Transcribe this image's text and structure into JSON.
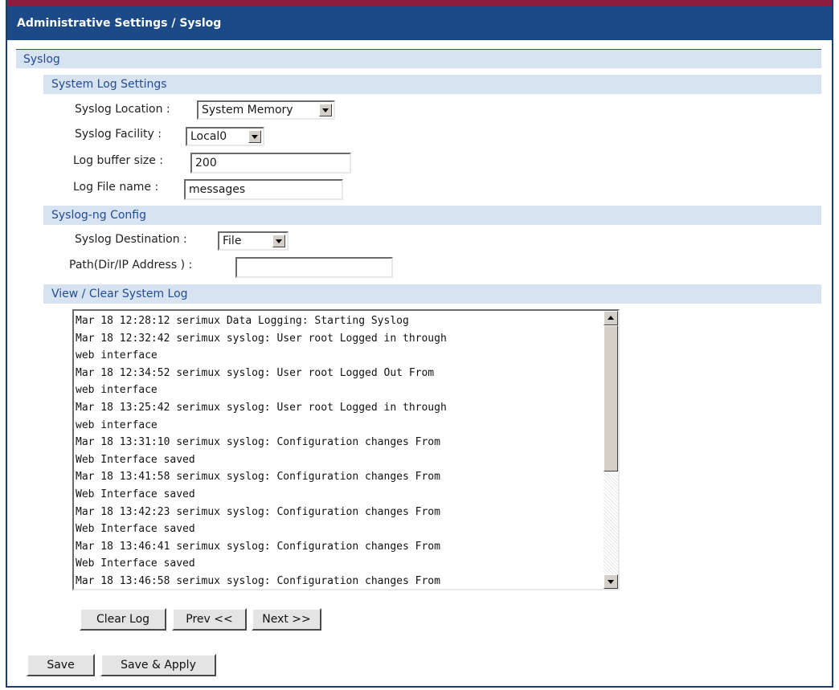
{
  "header": {
    "title": "Administrative Settings / Syslog"
  },
  "sections": {
    "syslog": "Syslog",
    "system_log_settings": "System Log Settings",
    "syslog_ng_config": "Syslog-ng Config",
    "view_clear": "View / Clear System Log"
  },
  "fields": {
    "syslog_location": {
      "label": "Syslog Location :",
      "value": "System Memory"
    },
    "syslog_facility": {
      "label": "Syslog Facility :",
      "value": "Local0"
    },
    "log_buffer_size": {
      "label": "Log buffer size :",
      "value": "200"
    },
    "log_file_name": {
      "label": "Log File name :",
      "value": "messages"
    },
    "syslog_destination": {
      "label": "Syslog Destination :",
      "value": "File"
    },
    "path": {
      "label": "Path(Dir/IP Address ) :",
      "value": ""
    }
  },
  "log": {
    "lines": [
      "Mar 18 12:28:12 serimux Data Logging: Starting Syslog",
      "Mar 18 12:32:42 serimux syslog: User root Logged in through",
      "web interface",
      "Mar 18 12:34:52 serimux syslog: User root Logged Out From",
      "web interface",
      "Mar 18 13:25:42 serimux syslog: User root Logged in through",
      "web interface",
      "Mar 18 13:31:10 serimux syslog: Configuration changes From",
      "Web Interface saved",
      "Mar 18 13:41:58 serimux syslog: Configuration changes From",
      "Web Interface saved",
      "Mar 18 13:42:23 serimux syslog: Configuration changes From",
      "Web Interface saved",
      "Mar 18 13:46:41 serimux syslog: Configuration changes From",
      "Web Interface saved",
      "Mar 18 13:46:58 serimux syslog: Configuration changes From"
    ]
  },
  "buttons": {
    "clear_log": "Clear Log",
    "prev": "Prev <<",
    "next": "Next >>",
    "save": "Save",
    "save_apply": "Save & Apply"
  }
}
